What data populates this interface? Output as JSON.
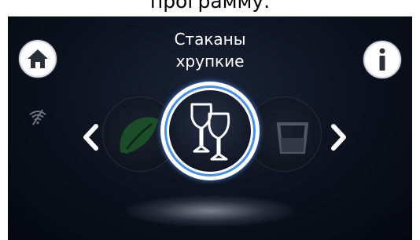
{
  "caption": {
    "text": "программу."
  },
  "header": {
    "title_line1": "Стаканы",
    "title_line2": "хрупкие"
  },
  "icons": {
    "home": "home-icon",
    "info": "info-icon",
    "wifi": "wifi-disconnected-icon",
    "prev": "chevron-left-icon",
    "next": "chevron-right-icon",
    "selected_program": "wine-glasses-icon",
    "prev_program": "eco-leaf-icon",
    "next_program": "tumbler-glass-icon"
  },
  "colors": {
    "screen_bg": "#0b111d",
    "selection_ring": "#4a8fe0",
    "icon": "#ffffff"
  }
}
